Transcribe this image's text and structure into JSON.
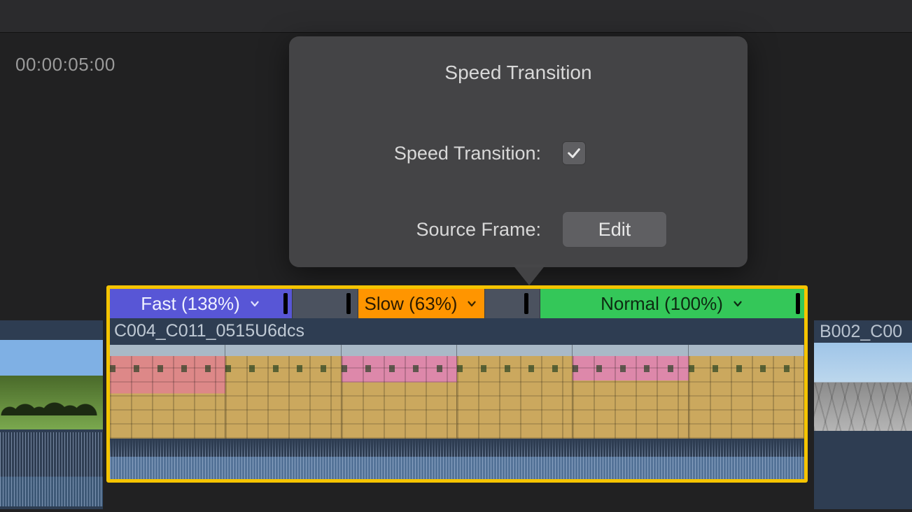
{
  "ruler": {
    "timecode": "00:00:05:00"
  },
  "popover": {
    "title": "Speed Transition",
    "speed_transition_label": "Speed Transition:",
    "speed_transition_checked": true,
    "source_frame_label": "Source Frame:",
    "edit_label": "Edit"
  },
  "clips": {
    "main": {
      "name": "C004_C011_0515U6dcs",
      "segments": [
        {
          "label": "Fast (138%)",
          "type": "fast"
        },
        {
          "label": "Slow (63%)",
          "type": "slow"
        },
        {
          "label": "Normal (100%)",
          "type": "normal"
        }
      ]
    },
    "next": {
      "name": "B002_C00"
    }
  }
}
